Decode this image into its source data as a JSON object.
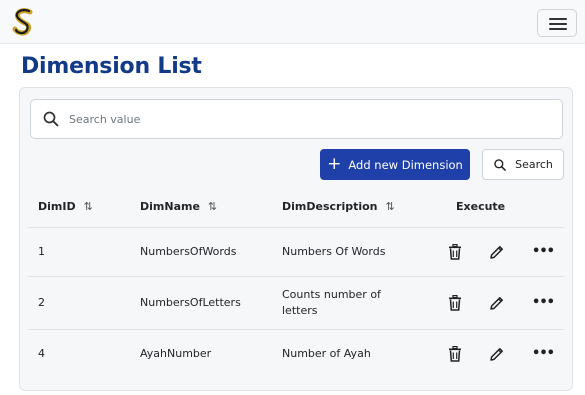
{
  "header": {
    "logo_icon": "s-logo-icon",
    "menu_icon": "hamburger-menu-icon"
  },
  "page": {
    "title": "Dimension List"
  },
  "search": {
    "placeholder": "Search value",
    "value": "",
    "icon": "search-icon"
  },
  "toolbar": {
    "add_label": "Add new Dimension",
    "search_label": "Search"
  },
  "table": {
    "columns": [
      "DimID",
      "DimName",
      "DimDescription",
      "Execute"
    ],
    "rows": [
      {
        "id": "1",
        "name": "NumbersOfWords",
        "description": "Numbers Of Words"
      },
      {
        "id": "2",
        "name": "NumbersOfLetters",
        "description": "Counts number of letters"
      },
      {
        "id": "4",
        "name": "AyahNumber",
        "description": "Number of Ayah"
      }
    ],
    "row_actions": [
      "trash-icon",
      "pencil-icon",
      "more-dots-icon"
    ]
  },
  "colors": {
    "title": "#123a86",
    "primary_button": "#1e40a8",
    "logo_gold": "#c9a227"
  }
}
